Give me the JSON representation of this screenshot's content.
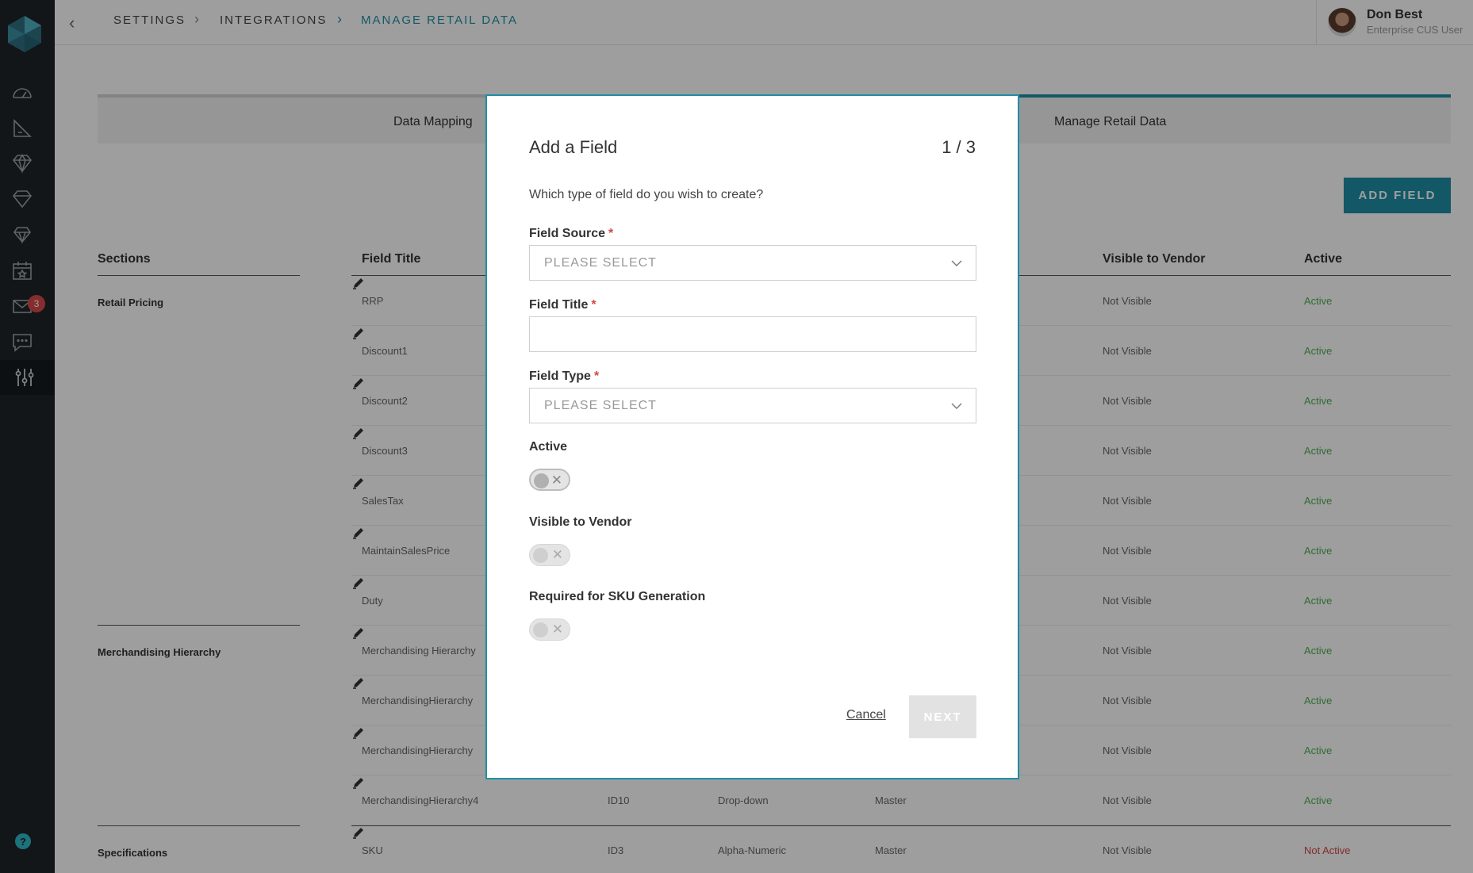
{
  "breadcrumb": {
    "items": [
      "SETTINGS",
      "INTEGRATIONS",
      "MANAGE RETAIL DATA"
    ]
  },
  "user": {
    "name": "Don Best",
    "role": "Enterprise CUS User"
  },
  "sidebar": {
    "mail_badge": "3",
    "help": "?"
  },
  "steps": {
    "step1": "Data Mapping",
    "step3": "Manage Retail Data"
  },
  "toolbar": {
    "add_field": "ADD FIELD"
  },
  "table": {
    "headers": {
      "sections": "Sections",
      "field_title": "Field Title",
      "visible_to_vendor": "Visible to Vendor",
      "active": "Active"
    },
    "sections": [
      "Retail Pricing",
      "Merchandising Hierarchy",
      "Specifications"
    ],
    "rows": [
      {
        "title": "RRP",
        "id": "",
        "type": "",
        "source": "",
        "visible": "Not Visible",
        "active": "Active"
      },
      {
        "title": "Discount1",
        "id": "",
        "type": "",
        "source": "",
        "visible": "Not Visible",
        "active": "Active"
      },
      {
        "title": "Discount2",
        "id": "",
        "type": "",
        "source": "",
        "visible": "Not Visible",
        "active": "Active"
      },
      {
        "title": "Discount3",
        "id": "",
        "type": "",
        "source": "",
        "visible": "Not Visible",
        "active": "Active"
      },
      {
        "title": "SalesTax",
        "id": "",
        "type": "",
        "source": "",
        "visible": "Not Visible",
        "active": "Active"
      },
      {
        "title": "MaintainSalesPrice",
        "id": "",
        "type": "",
        "source": "",
        "visible": "Not Visible",
        "active": "Active"
      },
      {
        "title": "Duty",
        "id": "",
        "type": "",
        "source": "",
        "visible": "Not Visible",
        "active": "Active"
      },
      {
        "title": "Merchandising Hierarchy",
        "id": "",
        "type": "",
        "source": "",
        "visible": "Not Visible",
        "active": "Active"
      },
      {
        "title": "MerchandisingHierarchy",
        "id": "",
        "type": "",
        "source": "",
        "visible": "Not Visible",
        "active": "Active"
      },
      {
        "title": "MerchandisingHierarchy",
        "id": "",
        "type": "",
        "source": "",
        "visible": "Not Visible",
        "active": "Active"
      },
      {
        "title": "MerchandisingHierarchy4",
        "id": "ID10",
        "type": "Drop-down",
        "source": "Master",
        "visible": "Not Visible",
        "active": "Active"
      },
      {
        "title": "SKU",
        "id": "ID3",
        "type": "Alpha-Numeric",
        "source": "Master",
        "visible": "Not Visible",
        "active": "Not Active"
      }
    ]
  },
  "modal": {
    "title": "Add a Field",
    "step": "1 / 3",
    "question": "Which type of field do you wish to create?",
    "field_source_label": "Field Source",
    "field_source_placeholder": "PLEASE SELECT",
    "field_title_label": "Field Title",
    "field_title_value": "",
    "field_type_label": "Field Type",
    "field_type_placeholder": "PLEASE SELECT",
    "required_mark": "*",
    "active_label": "Active",
    "visible_label": "Visible to Vendor",
    "sku_label": "Required for SKU Generation",
    "toggle_off_glyph": "✕",
    "cancel": "Cancel",
    "next": "NEXT"
  },
  "colors": {
    "accent": "#1f8fa6",
    "sidebar": "#1e2429",
    "active": "#4caf50",
    "inactive": "#d64545"
  }
}
